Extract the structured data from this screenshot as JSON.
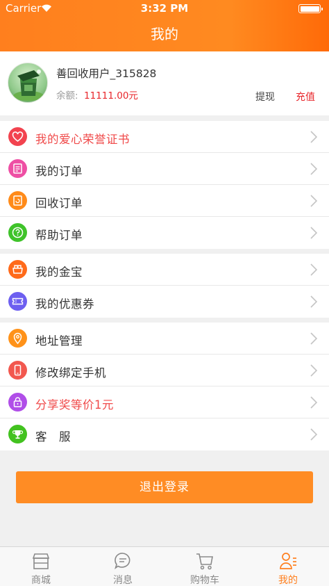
{
  "status_bar": {
    "carrier": "Carrier",
    "time": "3:32 PM"
  },
  "header": {
    "title": "我的"
  },
  "profile": {
    "username": "善回收用户_315828",
    "balance_label": "余额:",
    "balance_value": "11111.00元",
    "withdraw_label": "提现",
    "recharge_label": "充值"
  },
  "menu": {
    "group1": [
      {
        "label": "我的爱心荣誉证书",
        "icon": "heart-icon",
        "color": "#f2434f"
      },
      {
        "label": "我的订单",
        "icon": "clipboard-icon",
        "color": "#ee4fa4"
      },
      {
        "label": "回收订单",
        "icon": "recycle-doc-icon",
        "color": "#ff8b1a"
      },
      {
        "label": "帮助订单",
        "icon": "help-icon",
        "color": "#3fc32a"
      }
    ],
    "group2": [
      {
        "label": "我的金宝",
        "icon": "treasure-icon",
        "color": "#ff6a1a"
      },
      {
        "label": "我的优惠券",
        "icon": "ticket-icon",
        "color": "#6d5ff0"
      }
    ],
    "group3": [
      {
        "label": "地址管理",
        "icon": "location-icon",
        "color": "#ff9219"
      },
      {
        "label": "修改绑定手机",
        "icon": "phone-icon",
        "color": "#f2584f"
      },
      {
        "label": "分享奖等价1元",
        "icon": "lock-gift-icon",
        "color": "#b04ee8"
      },
      {
        "label": "客　服",
        "icon": "trophy-icon",
        "color": "#42c21f"
      }
    ]
  },
  "logout_label": "退出登录",
  "tabbar": [
    {
      "label": "商城",
      "icon": "shop-icon"
    },
    {
      "label": "消息",
      "icon": "message-icon"
    },
    {
      "label": "购物车",
      "icon": "cart-icon"
    },
    {
      "label": "我的",
      "icon": "profile-icon",
      "active": true
    }
  ],
  "colors": {
    "accent": "#ff7f1e",
    "price_red": "#e8262b",
    "background": "#f0f0f0"
  }
}
